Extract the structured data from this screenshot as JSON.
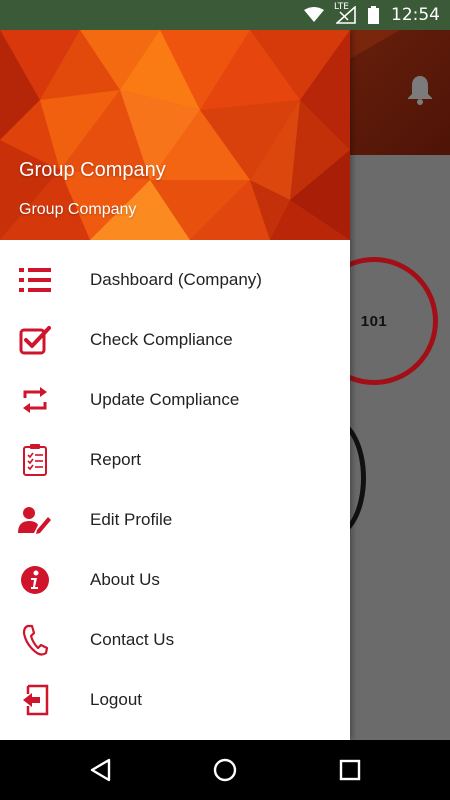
{
  "status_bar": {
    "network_label": "LTE",
    "time": "12:54"
  },
  "background_app": {
    "gauge_value": "101"
  },
  "drawer": {
    "header": {
      "title": "Group Company",
      "subtitle": "Group Company"
    },
    "items": [
      {
        "label": "Dashboard (Company)",
        "icon": "list-icon"
      },
      {
        "label": "Check Compliance",
        "icon": "checkbox-icon"
      },
      {
        "label": "Update Compliance",
        "icon": "sync-icon"
      },
      {
        "label": "Report",
        "icon": "clipboard-icon"
      },
      {
        "label": "Edit Profile",
        "icon": "user-edit-icon"
      },
      {
        "label": "About Us",
        "icon": "info-icon"
      },
      {
        "label": "Contact Us",
        "icon": "phone-icon"
      },
      {
        "label": "Logout",
        "icon": "logout-icon"
      }
    ]
  },
  "colors": {
    "accent": "#d0142c",
    "status_bar": "#3b5a38",
    "scrim": "#6b6b6b"
  }
}
